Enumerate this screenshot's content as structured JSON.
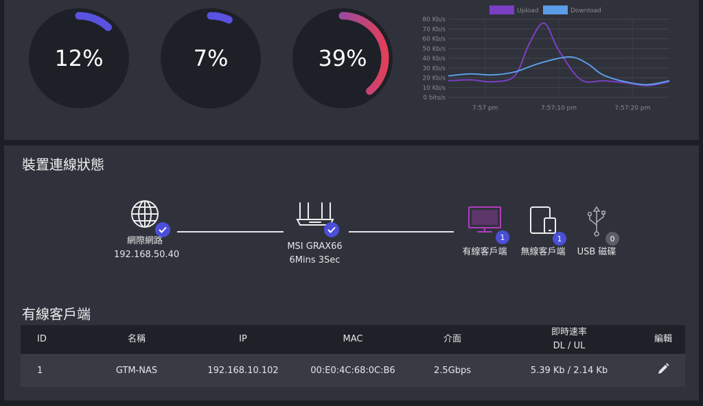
{
  "gauges": [
    {
      "label": "12%",
      "value": 0.12,
      "color": "#5a52e0"
    },
    {
      "label": "7%",
      "value": 0.07,
      "color": "#5a52e0"
    },
    {
      "label": "39%",
      "value": 0.39,
      "gradient": [
        "#5a52e0",
        "#e0405a"
      ]
    }
  ],
  "chart_data": {
    "type": "line",
    "legend": [
      "Upload",
      "Download"
    ],
    "legend_position": "top",
    "x_ticks": [
      "7:57 pm",
      "7:57:10 pm",
      "7:57:20 pm"
    ],
    "y_ticks": [
      "0 bits/s",
      "10 Kb/s",
      "20 Kb/s",
      "30 Kb/s",
      "40 Kb/s",
      "50 Kb/s",
      "60 Kb/s",
      "70 Kb/s",
      "80 Kb/s"
    ],
    "ylim": [
      0,
      80
    ],
    "xlim": [
      0,
      30
    ],
    "grid": true,
    "series": [
      {
        "name": "Upload",
        "color": "#7b3fc4",
        "x": [
          0,
          3,
          6,
          9,
          11,
          13,
          15,
          18,
          21,
          24,
          27,
          30
        ],
        "y": [
          17,
          18,
          16,
          22,
          55,
          76,
          48,
          18,
          17,
          15,
          12,
          16
        ]
      },
      {
        "name": "Download",
        "color": "#5b9ee8",
        "x": [
          0,
          3,
          6,
          9,
          12,
          15,
          17,
          19,
          21,
          24,
          27,
          30
        ],
        "y": [
          22,
          24,
          23,
          26,
          34,
          40,
          41,
          34,
          23,
          16,
          13,
          17
        ]
      }
    ]
  },
  "device_status": {
    "title": "裝置連線狀態",
    "internet": {
      "label": "網際網路",
      "ip": "192.168.50.40"
    },
    "router": {
      "name": "MSI  GRAX66",
      "uptime": "6Mins 3Sec"
    },
    "wired": {
      "label": "有線客戶端",
      "count": "1",
      "color": "#b03cc0"
    },
    "wireless": {
      "label": "無線客戶端",
      "count": "1"
    },
    "usb": {
      "label": "USB 磁碟",
      "count": "0"
    }
  },
  "wired_clients": {
    "title": "有線客戶端",
    "columns": {
      "id": "ID",
      "name": "名稱",
      "ip": "IP",
      "mac": "MAC",
      "interface": "介面",
      "rate": "即時速率",
      "rate_sub": "DL / UL",
      "edit": "編輯"
    },
    "rows": [
      {
        "id": "1",
        "name": "GTM-NAS",
        "ip": "192.168.10.102",
        "mac": "00:E0:4C:68:0C:B6",
        "interface": "2.5Gbps",
        "rate": "5.39 Kb / 2.14 Kb"
      }
    ]
  }
}
